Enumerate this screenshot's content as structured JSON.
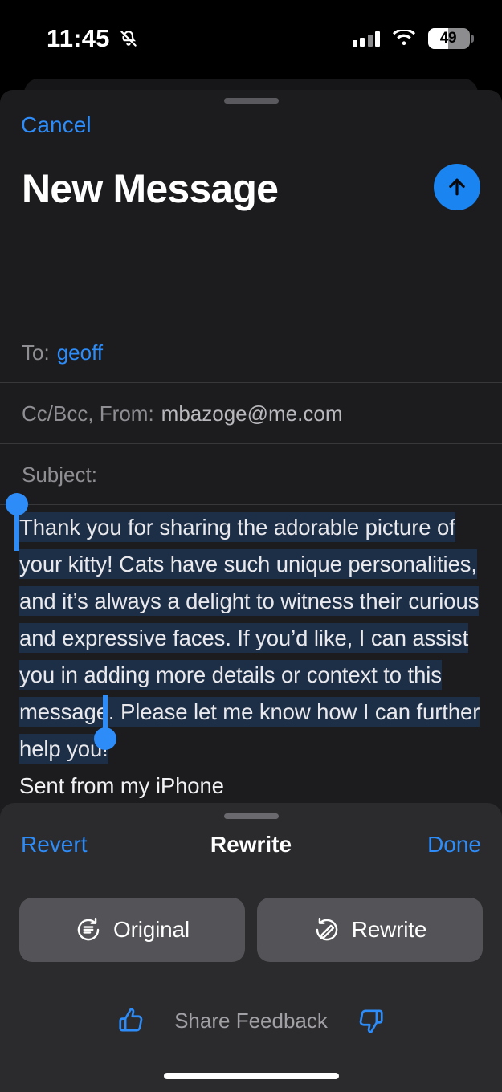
{
  "status_bar": {
    "time": "11:45",
    "silent_icon": "bell-slash-icon",
    "cellular_icon": "cellular-bars-icon",
    "wifi_icon": "wifi-icon",
    "battery_percent": "49",
    "battery_level": 49
  },
  "compose": {
    "cancel_label": "Cancel",
    "title": "New Message",
    "send_icon": "arrow-up-icon",
    "fields": {
      "to_label": "To:",
      "to_value": "geoff",
      "cc_label": "Cc/Bcc, From:",
      "cc_value": "mbazoge@me.com",
      "subject_label": "Subject:",
      "subject_value": ""
    },
    "body_selected": "Thank you for sharing the adorable picture of your kitty! Cats have such unique personalities, and it’s always a delight to witness their curious and expressive faces. If you’d like, I can assist you in adding more details or context to this message. Please let me know how I can further help you!",
    "body_signature": "Sent from my iPhone"
  },
  "rewrite_panel": {
    "revert_label": "Revert",
    "title": "Rewrite",
    "done_label": "Done",
    "options": [
      {
        "label": "Original",
        "icon": "rotate-left-document-icon"
      },
      {
        "label": "Rewrite",
        "icon": "rotate-right-pencil-icon"
      }
    ],
    "feedback": {
      "thumbs_up_icon": "thumbs-up-icon",
      "label": "Share Feedback",
      "thumbs_down_icon": "thumbs-down-icon"
    }
  },
  "colors": {
    "accent_blue": "#2d8cf8",
    "send_blue": "#1a84f0",
    "sheet_bg": "#1c1c1e",
    "panel_bg": "#2b2b2d",
    "option_bg": "#545458",
    "selection_bg": "#1d2f47",
    "secondary_text": "#8e8e93"
  }
}
